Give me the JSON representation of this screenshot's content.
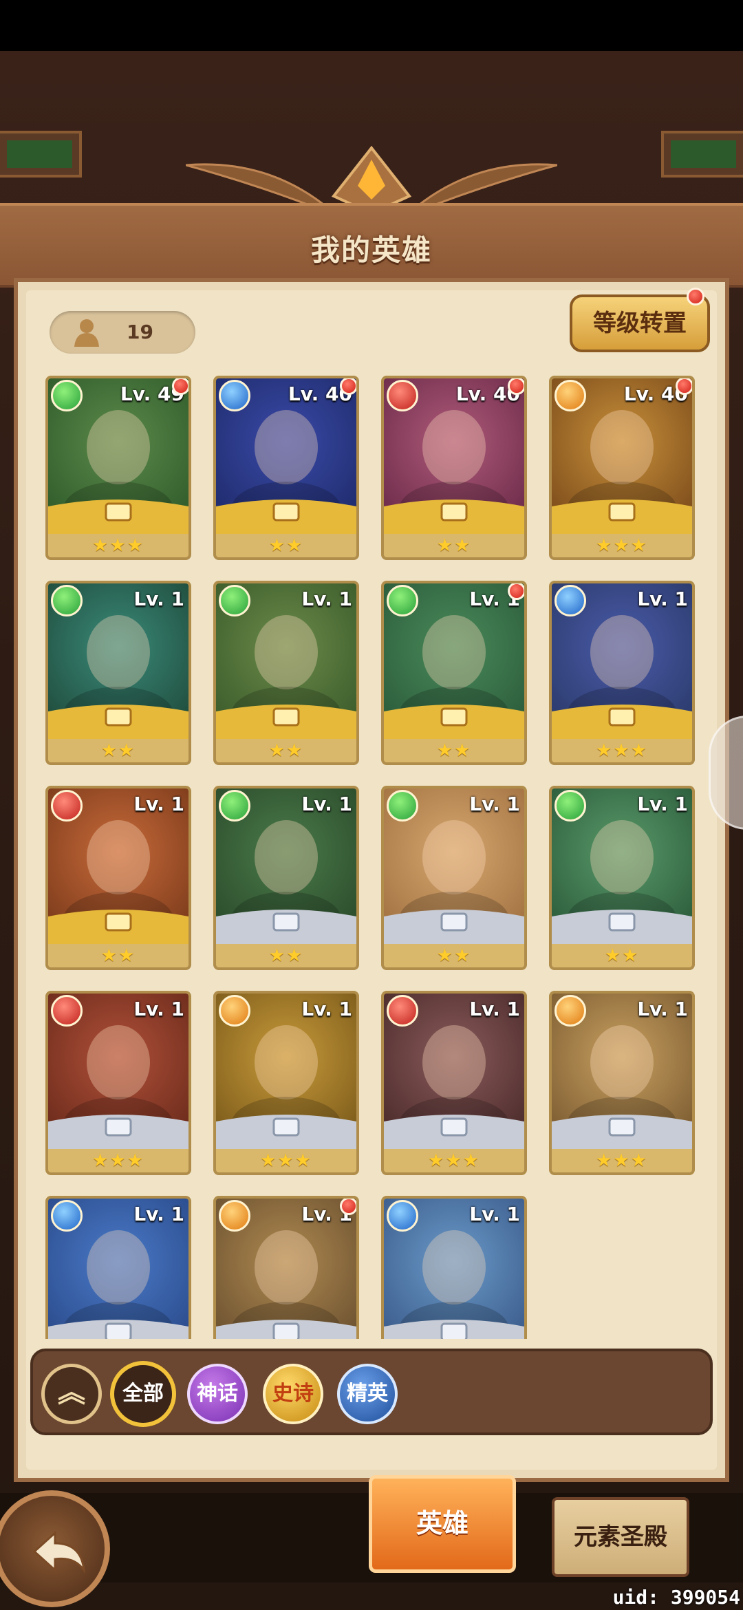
{
  "header": {
    "title": "我的英雄"
  },
  "hero_count": "19",
  "level_transfer_button": "等级转置",
  "heroes": [
    {
      "level": "Lv. 49",
      "stars": "★★★",
      "element": "green",
      "notify": true
    },
    {
      "level": "Lv. 40",
      "stars": "★★",
      "element": "blue",
      "notify": true
    },
    {
      "level": "Lv. 40",
      "stars": "★★",
      "element": "red",
      "notify": true
    },
    {
      "level": "Lv. 40",
      "stars": "★★★",
      "element": "orange",
      "notify": true
    },
    {
      "level": "Lv. 1",
      "stars": "★★",
      "element": "green",
      "notify": false
    },
    {
      "level": "Lv. 1",
      "stars": "★★",
      "element": "green",
      "notify": false
    },
    {
      "level": "Lv. 1",
      "stars": "★★",
      "element": "green",
      "notify": true
    },
    {
      "level": "Lv. 1",
      "stars": "★★★",
      "element": "blue",
      "notify": false
    },
    {
      "level": "Lv. 1",
      "stars": "★★",
      "element": "red",
      "notify": false
    },
    {
      "level": "Lv. 1",
      "stars": "★★",
      "element": "green",
      "notify": false
    },
    {
      "level": "Lv. 1",
      "stars": "★★",
      "element": "green",
      "notify": false
    },
    {
      "level": "Lv. 1",
      "stars": "★★",
      "element": "green",
      "notify": false
    },
    {
      "level": "Lv. 1",
      "stars": "★★★",
      "element": "red",
      "notify": false
    },
    {
      "level": "Lv. 1",
      "stars": "★★★",
      "element": "orange",
      "notify": false
    },
    {
      "level": "Lv. 1",
      "stars": "★★★",
      "element": "red",
      "notify": false
    },
    {
      "level": "Lv. 1",
      "stars": "★★★",
      "element": "orange",
      "notify": false
    },
    {
      "level": "Lv. 1",
      "stars": "",
      "element": "blue",
      "notify": false
    },
    {
      "level": "Lv. 1",
      "stars": "",
      "element": "orange",
      "notify": true
    },
    {
      "level": "Lv. 1",
      "stars": "",
      "element": "blue",
      "notify": false
    }
  ],
  "filters": {
    "all": "全部",
    "mythic": "神话",
    "epic": "史诗",
    "elite": "精英"
  },
  "tabs": {
    "heroes": "英雄",
    "element_temple": "元素圣殿"
  },
  "uid": "uid: 399054"
}
